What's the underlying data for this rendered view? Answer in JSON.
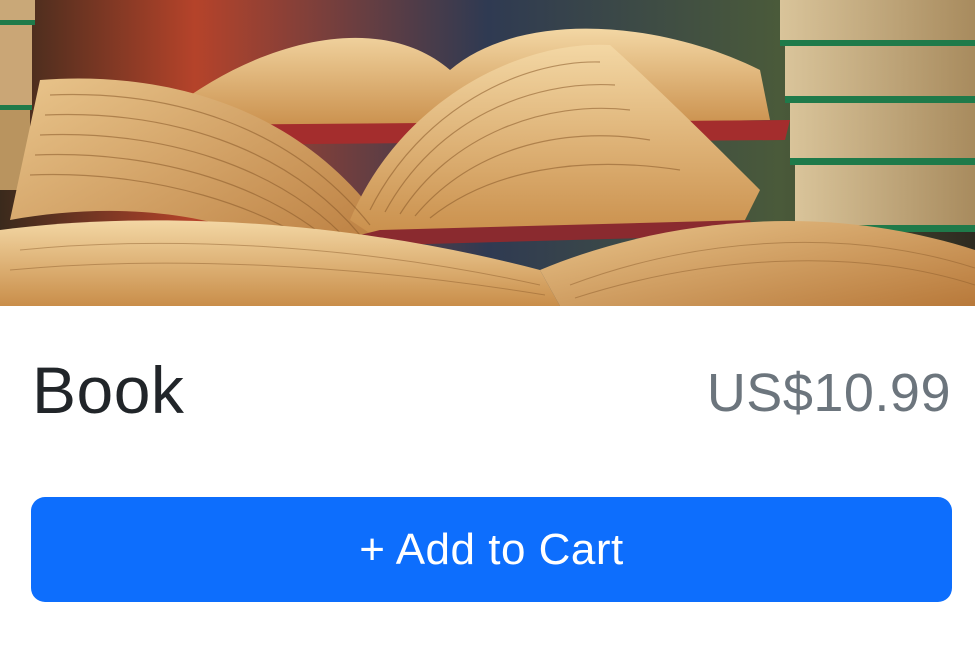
{
  "product": {
    "image_alt": "Open books",
    "name": "Book",
    "price": "US$10.99"
  },
  "actions": {
    "add_to_cart_label": "+ Add to Cart"
  },
  "colors": {
    "primary": "#0d6efd",
    "title": "#212529",
    "price": "#6c757d"
  }
}
